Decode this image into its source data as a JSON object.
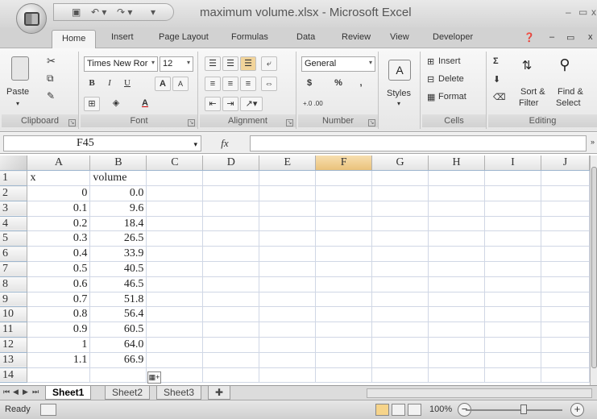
{
  "window": {
    "title": "maximum volume.xlsx - Microsoft Excel",
    "minimize": "–",
    "maximize": "▭",
    "close": "x"
  },
  "quick_access": {
    "save_icon": "save-icon",
    "undo_icon": "undo-icon",
    "redo_icon": "redo-icon"
  },
  "tabs": [
    "Home",
    "Insert",
    "Page Layout",
    "Formulas",
    "Data",
    "Review",
    "View",
    "Developer"
  ],
  "ribbon": {
    "clipboard": {
      "label": "Clipboard",
      "paste": "Paste"
    },
    "font": {
      "label": "Font",
      "name": "Times New Ror",
      "size": "12",
      "bold": "B",
      "italic": "I",
      "underline": "U",
      "grow": "A",
      "shrink": "A",
      "color": "A"
    },
    "alignment": {
      "label": "Alignment"
    },
    "number": {
      "label": "Number",
      "format": "General",
      "currency": "$",
      "percent": "%",
      "comma": ",",
      "inc_decimal": "+.0 .00",
      "dec_decimal": ".00 +.0"
    },
    "styles": {
      "label": "Styles"
    },
    "cells": {
      "label": "Cells",
      "insert": "Insert",
      "delete": "Delete",
      "format": "Format"
    },
    "editing": {
      "label": "Editing",
      "sort": "Sort &",
      "sort2": "Filter",
      "find": "Find &",
      "find2": "Select",
      "sigma": "Σ"
    }
  },
  "formula_bar": {
    "name_box": "F45",
    "fx": "fx",
    "value": ""
  },
  "columns": [
    "A",
    "B",
    "C",
    "D",
    "E",
    "F",
    "G",
    "H",
    "I",
    "J"
  ],
  "selected_column": "F",
  "rows": [
    {
      "n": "1",
      "a": "x",
      "b": "volume"
    },
    {
      "n": "2",
      "a": "0",
      "b": "0.0"
    },
    {
      "n": "3",
      "a": "0.1",
      "b": "9.6"
    },
    {
      "n": "4",
      "a": "0.2",
      "b": "18.4"
    },
    {
      "n": "5",
      "a": "0.3",
      "b": "26.5"
    },
    {
      "n": "6",
      "a": "0.4",
      "b": "33.9"
    },
    {
      "n": "7",
      "a": "0.5",
      "b": "40.5"
    },
    {
      "n": "8",
      "a": "0.6",
      "b": "46.5"
    },
    {
      "n": "9",
      "a": "0.7",
      "b": "51.8"
    },
    {
      "n": "10",
      "a": "0.8",
      "b": "56.4"
    },
    {
      "n": "11",
      "a": "0.9",
      "b": "60.5"
    },
    {
      "n": "12",
      "a": "1",
      "b": "64.0"
    },
    {
      "n": "13",
      "a": "1.1",
      "b": "66.9"
    },
    {
      "n": "14",
      "a": "",
      "b": ""
    }
  ],
  "sheets": [
    "Sheet1",
    "Sheet2",
    "Sheet3"
  ],
  "active_sheet": "Sheet1",
  "status": {
    "text": "Ready",
    "zoom": "100%"
  }
}
